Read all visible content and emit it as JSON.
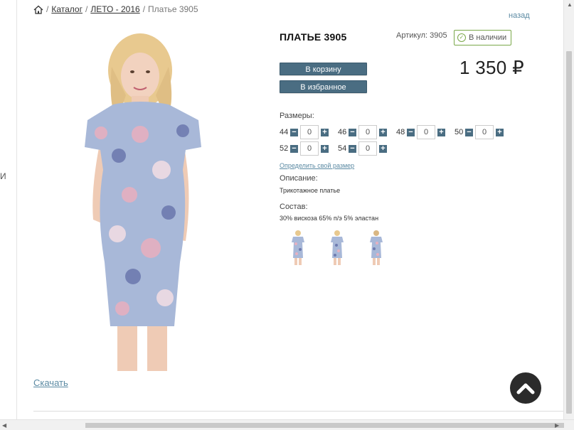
{
  "breadcrumb": {
    "items": [
      "Каталог",
      "ЛЕТО - 2016"
    ],
    "current": "Платье 3905",
    "separator": "/"
  },
  "back_link": "назад",
  "left_fragment": "И",
  "product": {
    "title": "ПЛАТЬЕ 3905",
    "sku": "Артикул: 3905",
    "stock": "В наличии",
    "price": "1 350 ₽",
    "cart_button": "В корзину",
    "favorite_button": "В избранное"
  },
  "sizes": {
    "label": "Размеры:",
    "row1": [
      {
        "size": "44",
        "qty": "0"
      },
      {
        "size": "46",
        "qty": "0"
      },
      {
        "size": "48",
        "qty": "0"
      },
      {
        "size": "50",
        "qty": "0"
      }
    ],
    "row2": [
      {
        "size": "52",
        "qty": "0"
      },
      {
        "size": "54",
        "qty": "0"
      }
    ],
    "minus": "−",
    "plus": "+",
    "custom_link": "Определить свой размер"
  },
  "description": {
    "label": "Описание:",
    "text": "Трикотажное платье"
  },
  "composition": {
    "label": "Состав:",
    "text": "30% вискоза 65% п/э 5% эластан"
  },
  "download": "Скачать",
  "colors": {
    "accent": "#4a6d82",
    "link": "#5b8aa3",
    "stock_border": "#7aa84a"
  }
}
